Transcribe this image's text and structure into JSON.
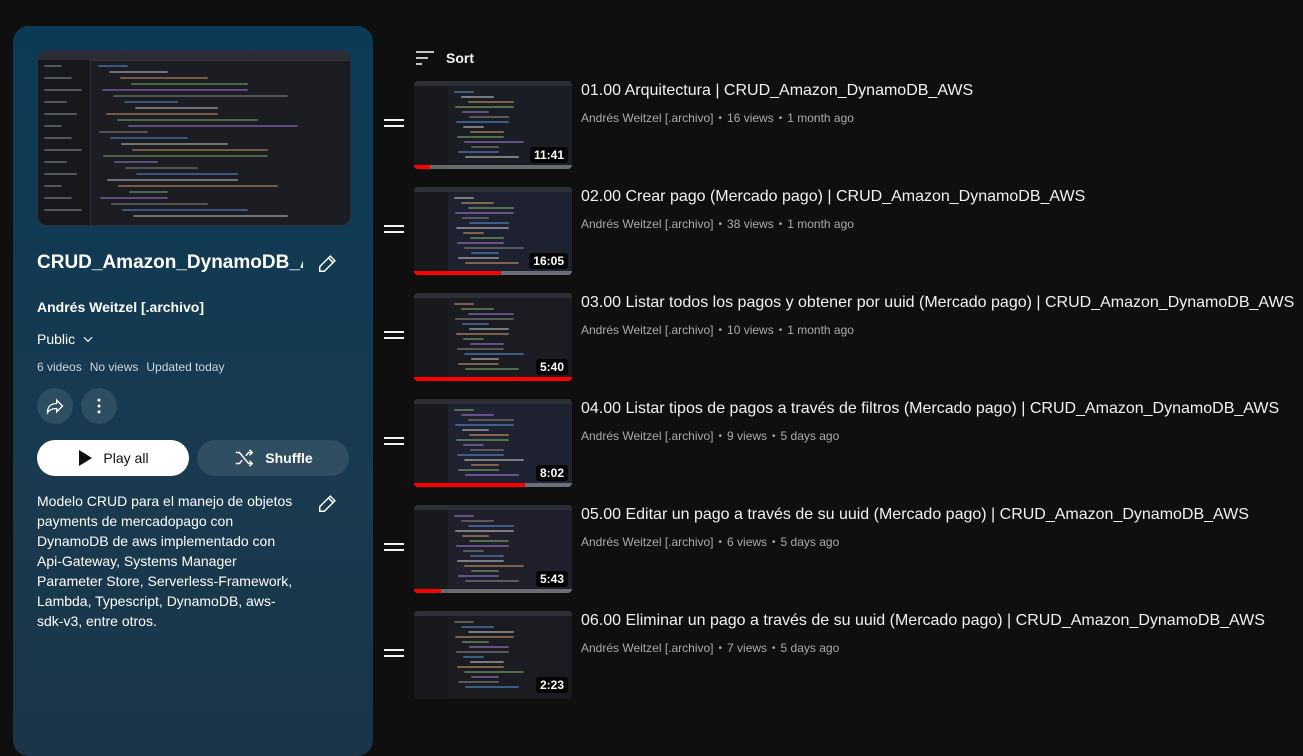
{
  "playlist": {
    "title": "CRUD_Amazon_DynamoDB_AWS",
    "owner": "Andrés Weitzel [.archivo]",
    "privacy": "Public",
    "video_count": "6 videos",
    "views": "No views",
    "updated": "Updated today",
    "play_all_label": "Play all",
    "shuffle_label": "Shuffle",
    "description": "Modelo CRUD para el manejo de objetos payments de mercadopago con DynamoDB de aws implementado con Api-Gateway, Systems Manager Parameter Store, Serverless-Framework, Lambda, Typescript, DynamoDB, aws-sdk-v3, entre otros."
  },
  "list": {
    "sort_label": "Sort",
    "videos": [
      {
        "title": "01.00 Arquitectura | CRUD_Amazon_DynamoDB_AWS",
        "channel": "Andrés Weitzel [.archivo]",
        "views": "16 views",
        "age": "1 month ago",
        "duration": "11:41",
        "watched": 0.1
      },
      {
        "title": "02.00 Crear pago (Mercado pago) | CRUD_Amazon_DynamoDB_AWS",
        "channel": "Andrés Weitzel [.archivo]",
        "views": "38 views",
        "age": "1 month ago",
        "duration": "16:05",
        "watched": 0.55
      },
      {
        "title": "03.00 Listar todos los pagos y obtener por uuid (Mercado pago) | CRUD_Amazon_DynamoDB_AWS",
        "channel": "Andrés Weitzel [.archivo]",
        "views": "10 views",
        "age": "1 month ago",
        "duration": "5:40",
        "watched": 1.0
      },
      {
        "title": "04.00 Listar tipos de pagos a través de filtros (Mercado pago) | CRUD_Amazon_DynamoDB_AWS",
        "channel": "Andrés Weitzel [.archivo]",
        "views": "9 views",
        "age": "5 days ago",
        "duration": "8:02",
        "watched": 0.7
      },
      {
        "title": "05.00 Editar un pago a través de su uuid (Mercado pago) | CRUD_Amazon_DynamoDB_AWS",
        "channel": "Andrés Weitzel [.archivo]",
        "views": "6 views",
        "age": "5 days ago",
        "duration": "5:43",
        "watched": 0.17
      },
      {
        "title": "06.00 Eliminar un pago a través de su uuid (Mercado pago) | CRUD_Amazon_DynamoDB_AWS",
        "channel": "Andrés Weitzel [.archivo]",
        "views": "7 views",
        "age": "5 days ago",
        "duration": "2:23",
        "watched": 0
      }
    ]
  },
  "colors": {
    "progress": "#ff0000",
    "panel_top": "#0c3a56",
    "panel_bottom": "#1b3447",
    "background": "#0f0f0f"
  }
}
